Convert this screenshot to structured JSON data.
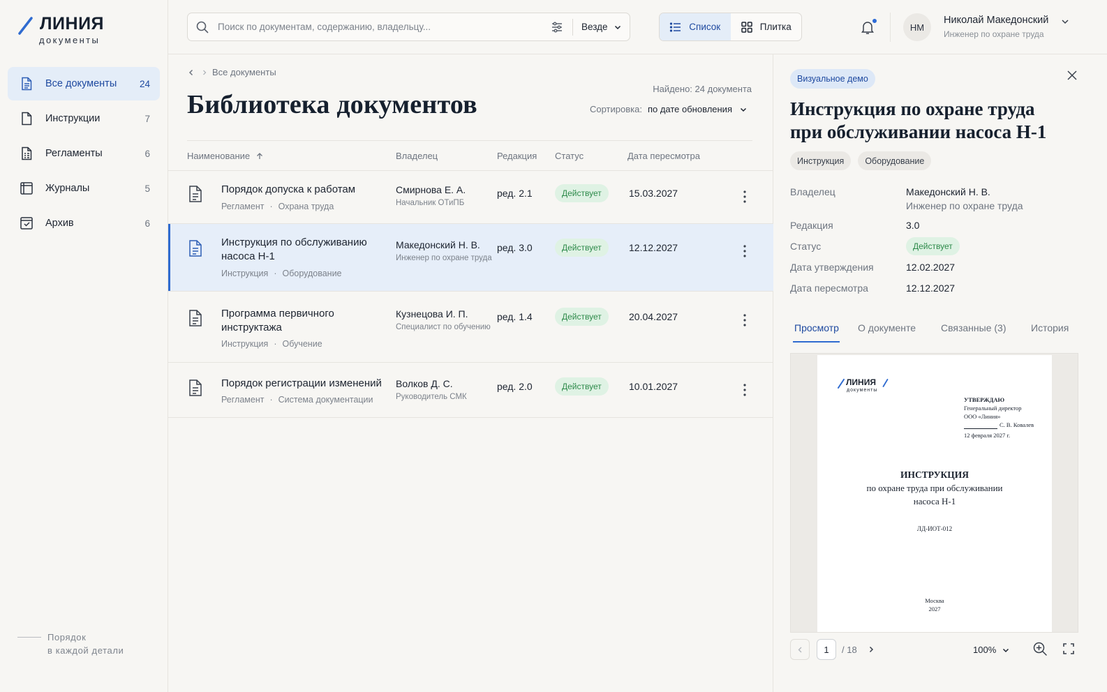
{
  "brand": {
    "name": "ЛИНИЯ",
    "sub": "документы",
    "motto_line1": "Порядок",
    "motto_line2": "в каждой детали"
  },
  "sidebar": {
    "items": [
      {
        "label": "Все документы",
        "count": "24",
        "icon": "file-text-icon",
        "active": true
      },
      {
        "label": "Инструкции",
        "count": "7",
        "icon": "file-icon"
      },
      {
        "label": "Регламенты",
        "count": "6",
        "icon": "file-lines-icon"
      },
      {
        "label": "Журналы",
        "count": "5",
        "icon": "journal-icon"
      },
      {
        "label": "Архив",
        "count": "6",
        "icon": "archive-icon"
      }
    ]
  },
  "header": {
    "search_placeholder": "Поиск по документам, содержанию, владельцу...",
    "scope": "Везде",
    "view_list": "Список",
    "view_tiles": "Плитка",
    "user_initials": "НМ",
    "user_name": "Николай Македонский",
    "user_role": "Инженер по охране труда"
  },
  "main": {
    "breadcrumb": "Все документы",
    "title": "Библиотека документов",
    "found": "Найдено: 24 документа",
    "sort_label": "Сортировка:",
    "sort_value": "по дате обновления",
    "columns": {
      "name": "Наименование",
      "owner": "Владелец",
      "revision": "Редакция",
      "status": "Статус",
      "review_date": "Дата пересмотра"
    },
    "rows": [
      {
        "title": "Порядок допуска к работам",
        "type": "Регламент",
        "category": "Охрана труда",
        "owner": "Смирнова Е. А.",
        "owner_role": "Начальник ОТиПБ",
        "revision": "ред. 2.1",
        "status": "Действует",
        "date": "15.03.2027"
      },
      {
        "title": "Инструкция по обслуживанию насоса Н-1",
        "type": "Инструкция",
        "category": "Оборудование",
        "owner": "Македонский Н. В.",
        "owner_role": "Инженер по охране труда",
        "revision": "ред. 3.0",
        "status": "Действует",
        "date": "12.12.2027"
      },
      {
        "title": "Программа первичного инструктажа",
        "type": "Инструкция",
        "category": "Обучение",
        "owner": "Кузнецова И. П.",
        "owner_role": "Специалист по обучению",
        "revision": "ред. 1.4",
        "status": "Действует",
        "date": "20.04.2027"
      },
      {
        "title": "Порядок регистрации изменений",
        "type": "Регламент",
        "category": "Система документации",
        "owner": "Волков Д. С.",
        "owner_role": "Руководитель СМК",
        "revision": "ред. 2.0",
        "status": "Действует",
        "date": "10.01.2027"
      }
    ]
  },
  "panel": {
    "badge": "Визуальное демо",
    "title": "Инструкция по охране труда при обслуживании насоса Н-1",
    "tags": [
      "Инструкция",
      "Оборудование"
    ],
    "props": {
      "owner_key": "Владелец",
      "owner_value": "Македонский Н. В.",
      "owner_role": "Инженер по охране труда",
      "revision_key": "Редакция",
      "revision_value": "3.0",
      "status_key": "Статус",
      "status_value": "Действует",
      "approved_key": "Дата утверждения",
      "approved_value": "12.02.2027",
      "review_key": "Дата пересмотра",
      "review_value": "12.12.2027"
    },
    "tabs": [
      "Просмотр",
      "О документе",
      "Связанные (3)",
      "История"
    ],
    "preview": {
      "logo": "ЛИНИЯ",
      "logo_sub": "документы",
      "approve_title": "УТВЕРЖДАЮ",
      "approve_role": "Генеральный директор",
      "approve_org": "ООО «Линия»",
      "approve_sign": "С. В. Ковалев",
      "approve_date": "12 февраля 2027 г.",
      "doc_kind": "ИНСТРУКЦИЯ",
      "doc_line1": "по охране труда при обслуживании",
      "doc_line2": "насоса Н-1",
      "doc_code": "ЛД-ИОТ-012",
      "city": "Москва",
      "year": "2027"
    },
    "pager": {
      "page": "1",
      "total": "/ 18",
      "zoom": "100%"
    }
  },
  "colors": {
    "accent": "#2f6bd0",
    "active_bg": "#e4edf8",
    "status_green": "#2d8a4a",
    "status_bg": "#dff2e4"
  }
}
